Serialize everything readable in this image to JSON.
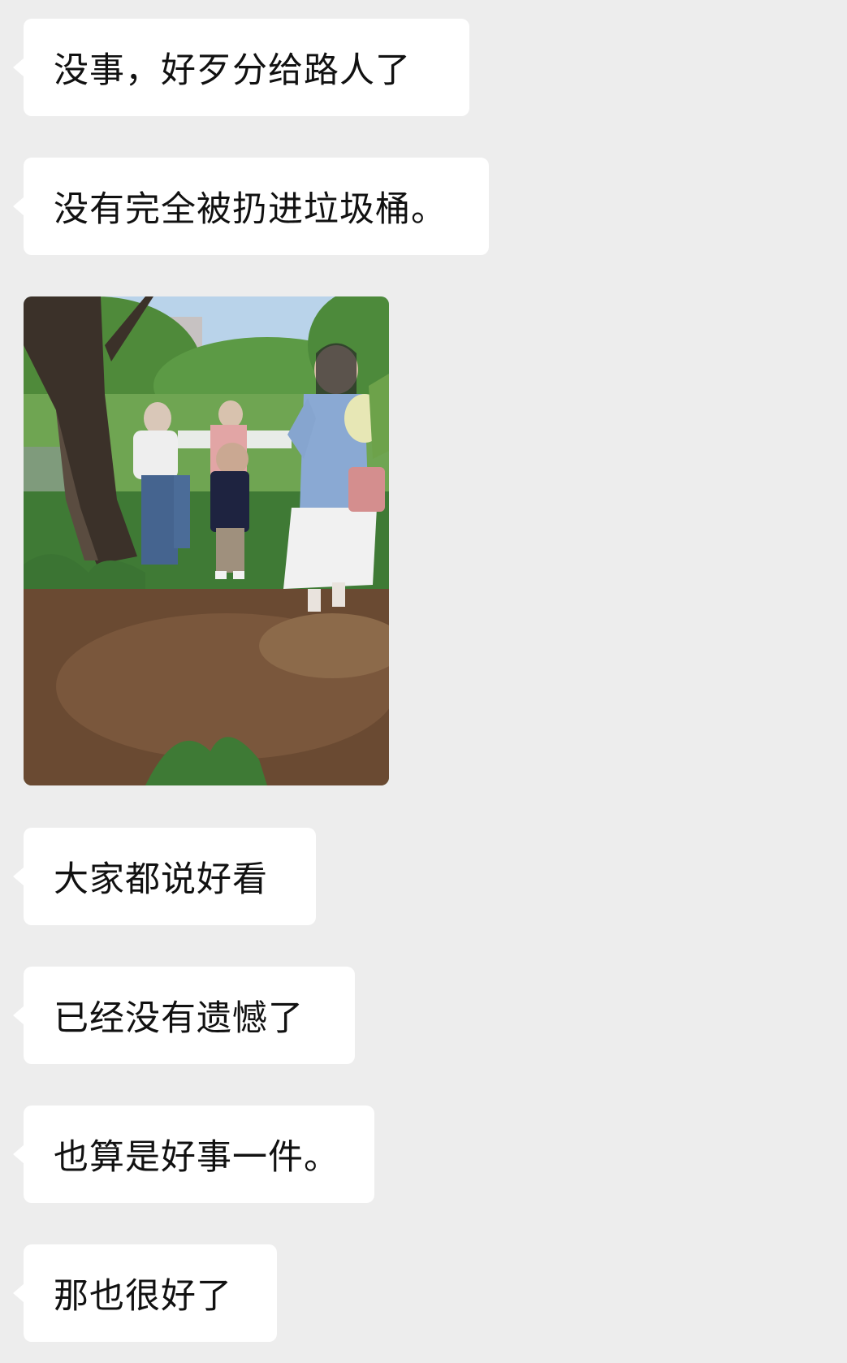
{
  "messages": [
    {
      "text": "没事，好歹分给路人了"
    },
    {
      "text": "没有完全被扔进垃圾桶。"
    },
    {
      "image": "photo of people in a park by a tree with greenery"
    },
    {
      "text": "大家都说好看"
    },
    {
      "text": "已经没有遗憾了"
    },
    {
      "text": "也算是好事一件。"
    },
    {
      "text": "那也很好了"
    }
  ]
}
